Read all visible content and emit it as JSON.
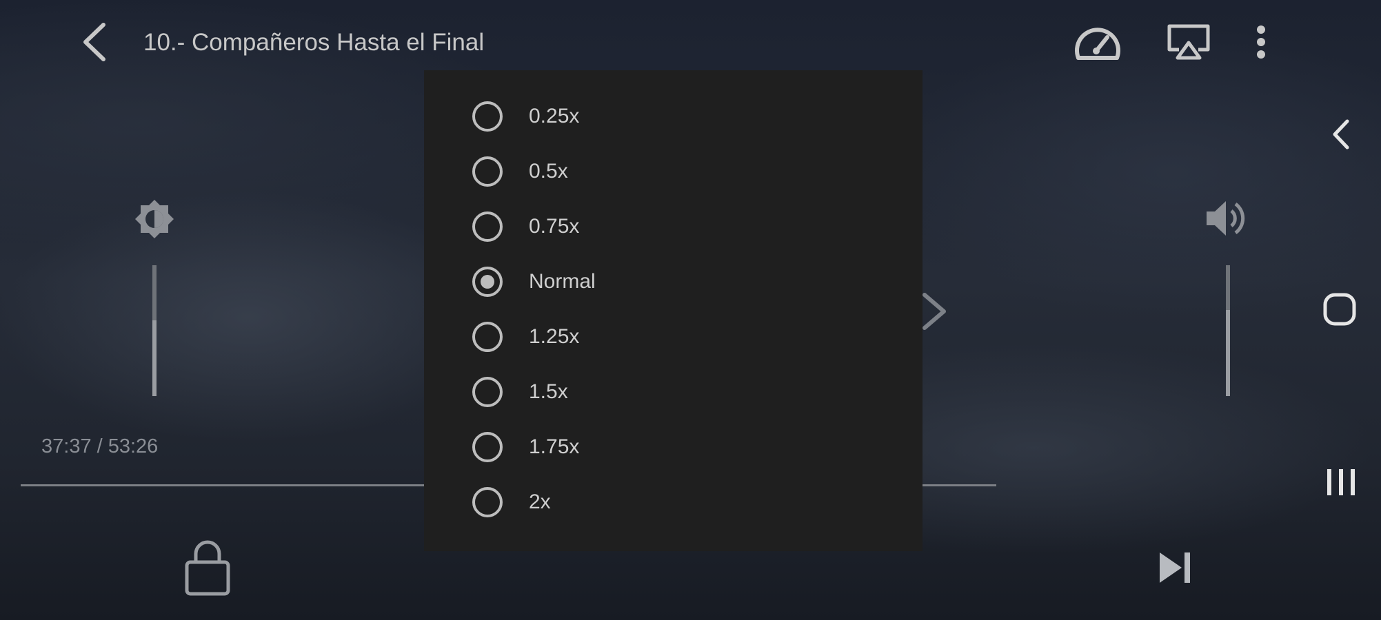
{
  "header": {
    "title": "10.- Compañeros Hasta el Final"
  },
  "icons": {
    "back": "back-arrow-icon",
    "speed": "playback-speed-icon",
    "cast": "airplay-cast-icon",
    "more": "more-vertical-icon",
    "brightness": "brightness-icon",
    "volume": "volume-icon",
    "lock": "lock-icon",
    "skip_next": "skip-next-icon",
    "nav_back": "nav-back-icon",
    "nav_home": "nav-home-icon",
    "nav_recents": "nav-recents-icon"
  },
  "player": {
    "time": "37:37 / 53:26",
    "progress_fraction": 0.704,
    "brightness_level": 0.58,
    "volume_level": 0.66
  },
  "speed_menu": {
    "selected": "Normal",
    "options": [
      "0.25x",
      "0.5x",
      "0.75x",
      "Normal",
      "1.25x",
      "1.5x",
      "1.75x",
      "2x"
    ]
  },
  "colors": {
    "menu_background": "#1f1f1f",
    "icon": "#c8c8c8",
    "radio": "#bdbdbd"
  }
}
